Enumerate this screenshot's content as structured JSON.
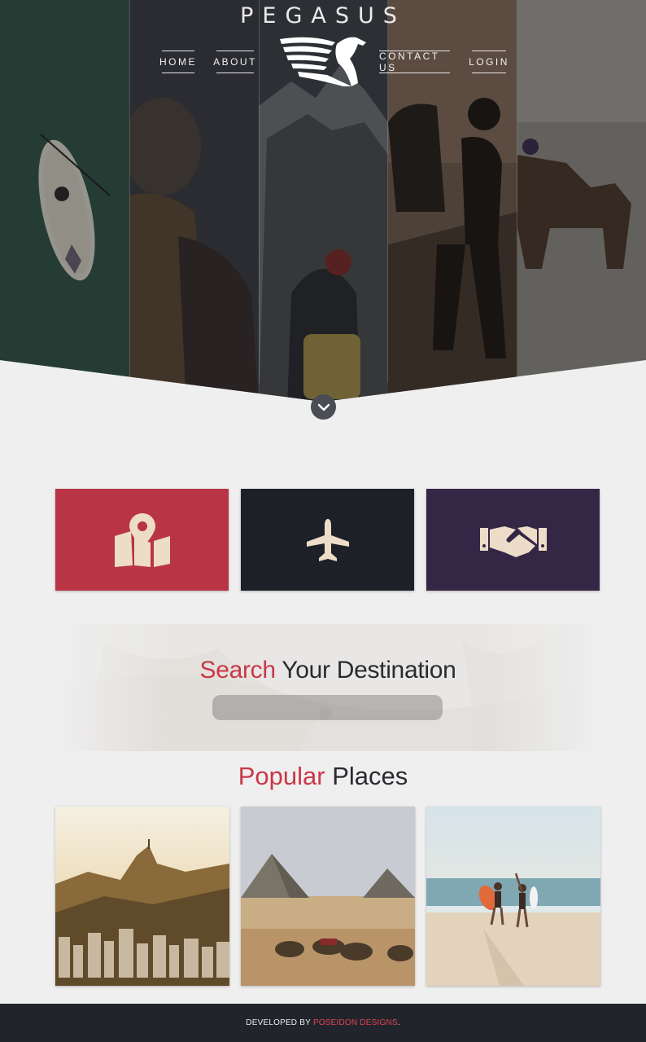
{
  "brand": {
    "name": "PEGASUS"
  },
  "nav": {
    "home": "HOME",
    "about": "ABOUT",
    "contact": "CONTACT US",
    "login": "LOGIN"
  },
  "icons": {
    "down": "chevron-down-icon",
    "tile1": "map-location-icon",
    "tile2": "plane-icon",
    "tile3": "handshake-icon"
  },
  "colors": {
    "tile1": "#b93545",
    "tile2": "#1d2027",
    "tile3": "#332745",
    "accent": "#c93848",
    "footer": "#22242c"
  },
  "search": {
    "title_accent": "Search",
    "title_rest": " Your Destination",
    "placeholder": ""
  },
  "popular": {
    "title_accent": "Popular",
    "title_rest": " Places"
  },
  "footer": {
    "prefix": "DEVELOPED BY ",
    "company": "POSEIDON DESIGNS",
    "suffix": "."
  }
}
